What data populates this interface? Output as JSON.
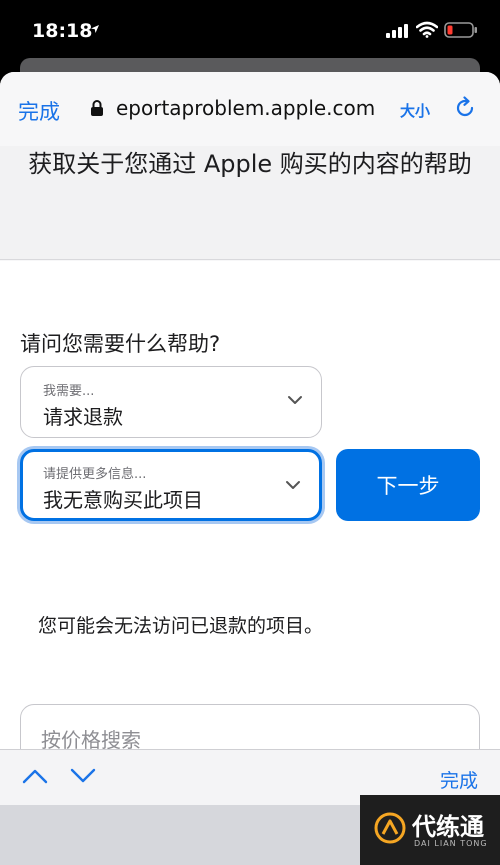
{
  "status_bar": {
    "time": "18:18"
  },
  "browser": {
    "done_label": "完成",
    "url": "eportaproblem.apple.com",
    "text_size_label": "大小"
  },
  "page": {
    "title": "获取关于您通过 Apple 购买的内容的帮助",
    "question": "请问您需要什么帮助?",
    "need_select": {
      "label": "我需要...",
      "value": "请求退款"
    },
    "more_select": {
      "label": "请提供更多信息...",
      "value": "我无意购买此项目"
    },
    "next_label": "下一步",
    "warning": "您可能会无法访问已退款的项目。",
    "search": {
      "placeholder": "按价格搜索",
      "value": ""
    }
  },
  "accessory": {
    "done_label": "完成"
  },
  "watermark": {
    "text": "代练通",
    "sub": "DAI LIAN TONG"
  },
  "colors": {
    "accent": "#0071e3",
    "link": "#1a73e8",
    "focus_ring": "#a7c8f2"
  },
  "icons": [
    "location-arrow-icon",
    "signal-icon",
    "wifi-icon",
    "battery-low-icon",
    "lock-icon",
    "reload-icon",
    "chevron-down-icon",
    "chevron-up-icon",
    "watermark-logo-icon"
  ]
}
